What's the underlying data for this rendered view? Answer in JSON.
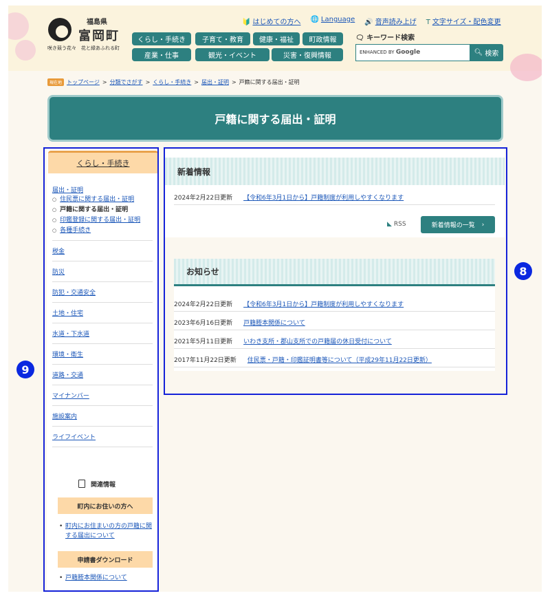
{
  "header": {
    "prefecture": "福島県",
    "town": "富岡町",
    "slogan": "咲き競う花々　花と緑あふれる町",
    "utility_links": [
      {
        "icon": "beginner-icon",
        "label": "はじめての方へ"
      },
      {
        "icon": "globe-icon",
        "label": "Language"
      },
      {
        "icon": "speaker-icon",
        "label": "音声読み上げ"
      },
      {
        "icon": "text-size-icon",
        "label": "文字サイズ・配色変更"
      }
    ],
    "nav_row1": [
      "くらし・手続き",
      "子育て・教育",
      "健康・福祉",
      "町政情報"
    ],
    "nav_row2": [
      "産業・仕事",
      "観光・イベント",
      "災害・復興情報"
    ],
    "search": {
      "label": "キーワード検索",
      "enhanced": "ENHANCED BY",
      "brand": "Google",
      "button": "検索"
    }
  },
  "breadcrumb": {
    "badge": "現在地",
    "items": [
      "トップページ",
      "分類でさがす",
      "くらし・手続き",
      "届出・証明"
    ],
    "current": "戸籍に関する届出・証明",
    "sep": ">"
  },
  "page_title": "戸籍に関する届出・証明",
  "sidebar": {
    "heading": "くらし・手続き",
    "sub_title": "届出・証明",
    "sub_items": [
      {
        "label": "住民票に関する届出・証明",
        "current": false
      },
      {
        "label": "戸籍に関する届出・証明",
        "current": true
      },
      {
        "label": "印鑑登録に関する届出・証明",
        "current": false
      },
      {
        "label": "各種手続き",
        "current": false
      }
    ],
    "items": [
      "税金",
      "防災",
      "防犯・交通安全",
      "土地・住宅",
      "水道・下水道",
      "環境・衛生",
      "道路・交通",
      "マイナンバー",
      "施設案内",
      "ライフイベント"
    ],
    "related": {
      "title": "関連情報",
      "group1": "町内にお住いの方へ",
      "group1_link": "町内にお住まいの方の戸籍に関する届出について",
      "group2": "申請書ダウンロード",
      "group2_link": "戸籍謄本関係について"
    }
  },
  "news": {
    "title": "新着情報",
    "items": [
      {
        "date": "2024年2月22日更新",
        "title": "【令和6年3月1日から】戸籍制度が利用しやすくなります"
      }
    ],
    "rss": "RSS",
    "more": "新着情報の一覧"
  },
  "notices": {
    "title": "お知らせ",
    "items": [
      {
        "date": "2024年2月22日更新",
        "title": "【令和6年3月1日から】戸籍制度が利用しやすくなります"
      },
      {
        "date": "2023年6月16日更新",
        "title": "戸籍謄本関係について"
      },
      {
        "date": "2021年5月11日更新",
        "title": "いわき支所・郡山支所での戸籍届の休日受付について"
      },
      {
        "date": "2017年11月22日更新",
        "title": "住民票・戸籍・印鑑証明書等について（平成29年11月22日更新）"
      }
    ]
  },
  "markers": {
    "main": "8",
    "sidebar": "9"
  }
}
